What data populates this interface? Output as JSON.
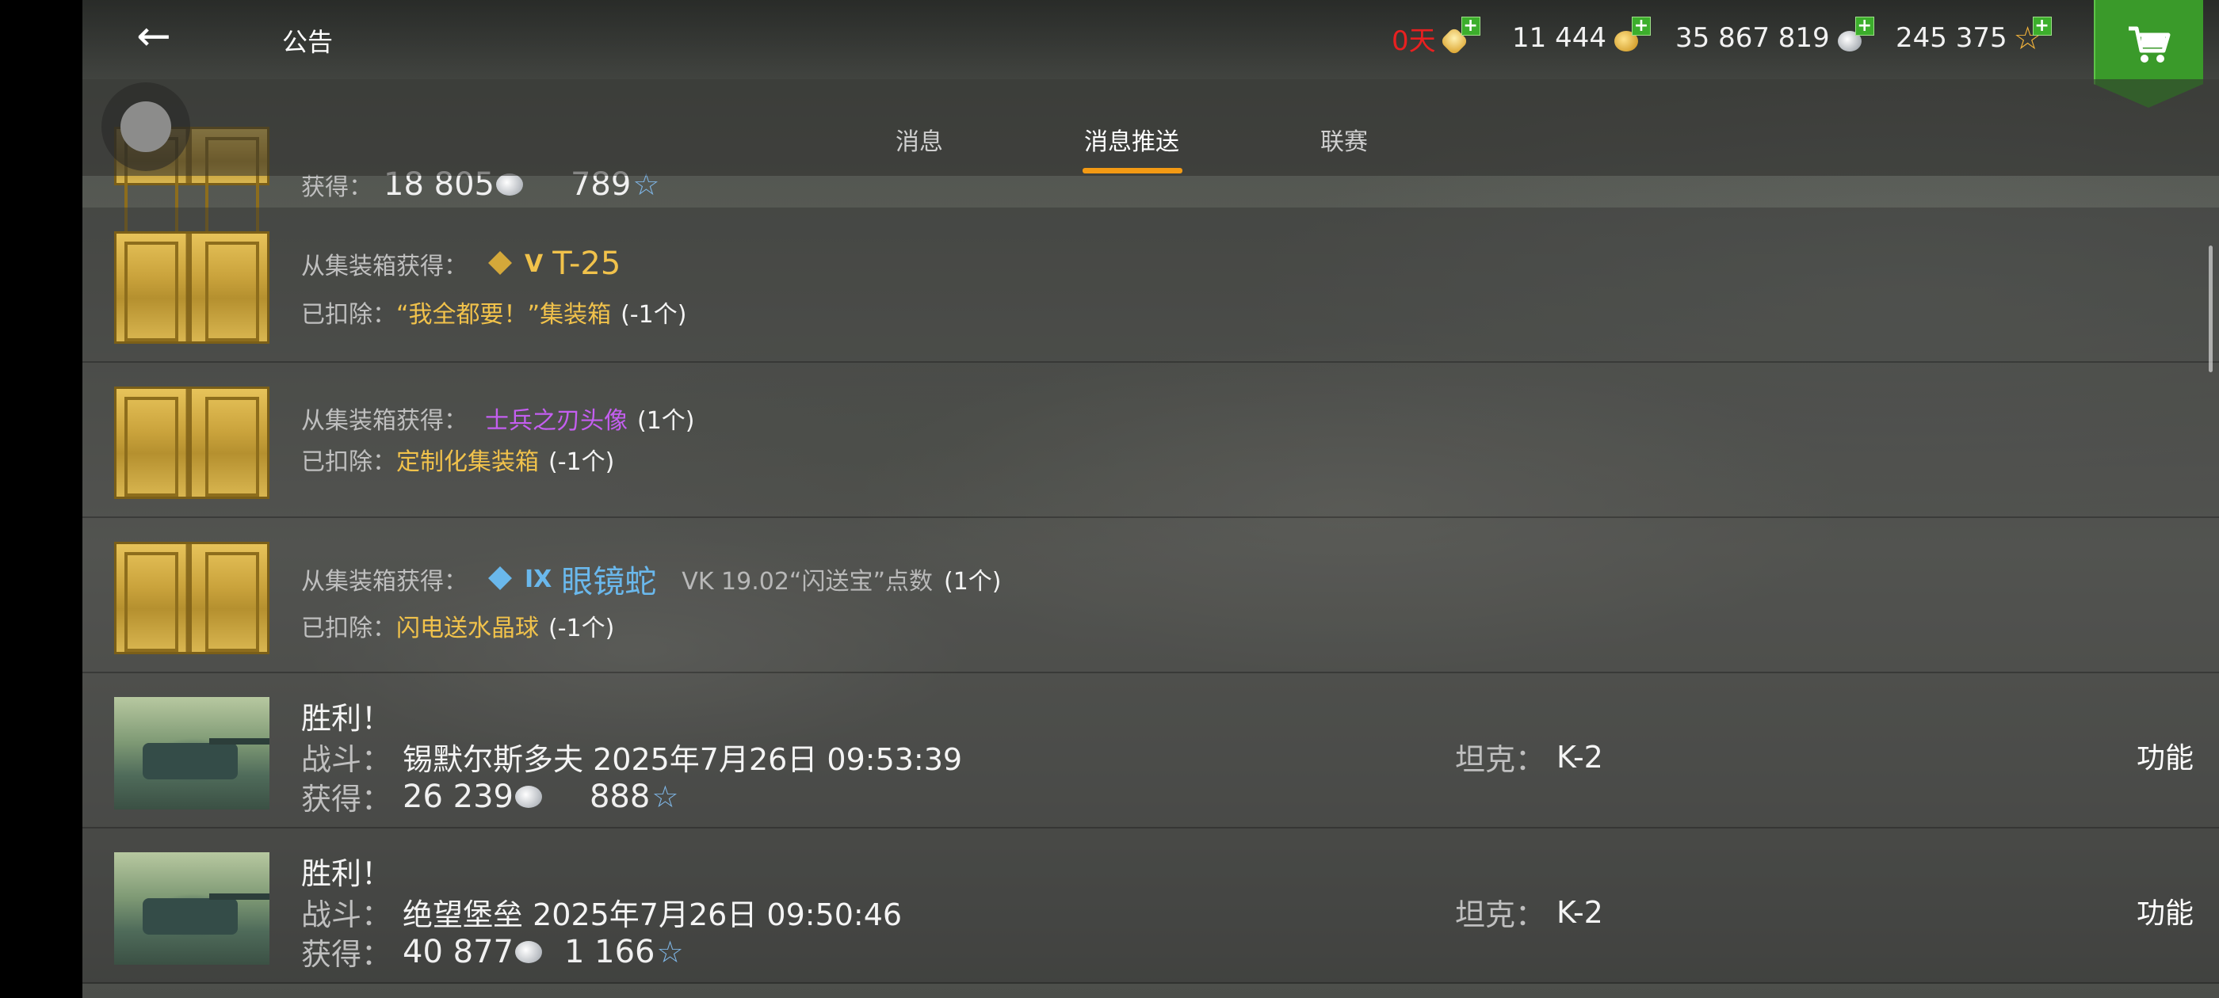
{
  "header": {
    "title": "公告",
    "premium": {
      "value": "0天",
      "color": "#e82020"
    },
    "gold": "11 444",
    "credits": "35 867 819",
    "free_xp": "245 375"
  },
  "tabs": [
    {
      "label": "消息",
      "active": false
    },
    {
      "label": "消息推送",
      "active": true
    },
    {
      "label": "联赛",
      "active": false
    }
  ],
  "partial_row": {
    "label": "获得：",
    "credits": "18 805",
    "xp": "789"
  },
  "crate_rows": [
    {
      "line1_label": "从集装箱获得：",
      "tier": "V",
      "item": "T-25",
      "item_color": "gold",
      "extra": "",
      "count": "",
      "line2_label": "已扣除：",
      "deducted": "“我全都要！”集装箱",
      "deducted_count": "(-1个)"
    },
    {
      "line1_label": "从集装箱获得：",
      "tier": "",
      "item": "士兵之刃头像",
      "item_color": "purple",
      "extra": "",
      "count": "(1个)",
      "line2_label": "已扣除：",
      "deducted": "定制化集装箱",
      "deducted_count": "(-1个)"
    },
    {
      "line1_label": "从集装箱获得：",
      "tier": "IX",
      "item": "眼镜蛇",
      "item_color": "blue",
      "extra": "VK 19.02“闪送宝”点数",
      "count": "(1个)",
      "line2_label": "已扣除：",
      "deducted": "闪电送水晶球",
      "deducted_count": "(-1个)"
    }
  ],
  "battle_rows": [
    {
      "title": "胜利！",
      "battle_label": "战斗：",
      "battle": "锡默尔斯多夫 2025年7月26日 09:53:39",
      "earn_label": "获得：",
      "credits": "26 239",
      "xp": "888",
      "tank_label": "坦克：",
      "tank": "K-2",
      "func": "功能"
    },
    {
      "title": "胜利！",
      "battle_label": "战斗：",
      "battle": "绝望堡垒 2025年7月26日 09:50:46",
      "earn_label": "获得：",
      "credits": "40 877",
      "xp": "1 166",
      "tank_label": "坦克：",
      "tank": "K-2",
      "func": "功能"
    }
  ],
  "icons": {
    "back": "arrow-left-icon",
    "premium": "premium-icon",
    "gold": "gold-coins-icon",
    "credits": "silver-coins-icon",
    "free_xp": "star-icon",
    "shop": "shopping-cart-icon"
  },
  "colors": {
    "accent": "#f39a14",
    "gold_text": "#f1c24b",
    "purple_text": "#c45ef0",
    "blue_text": "#6ab8ec",
    "shop": "#3a9a2a"
  }
}
